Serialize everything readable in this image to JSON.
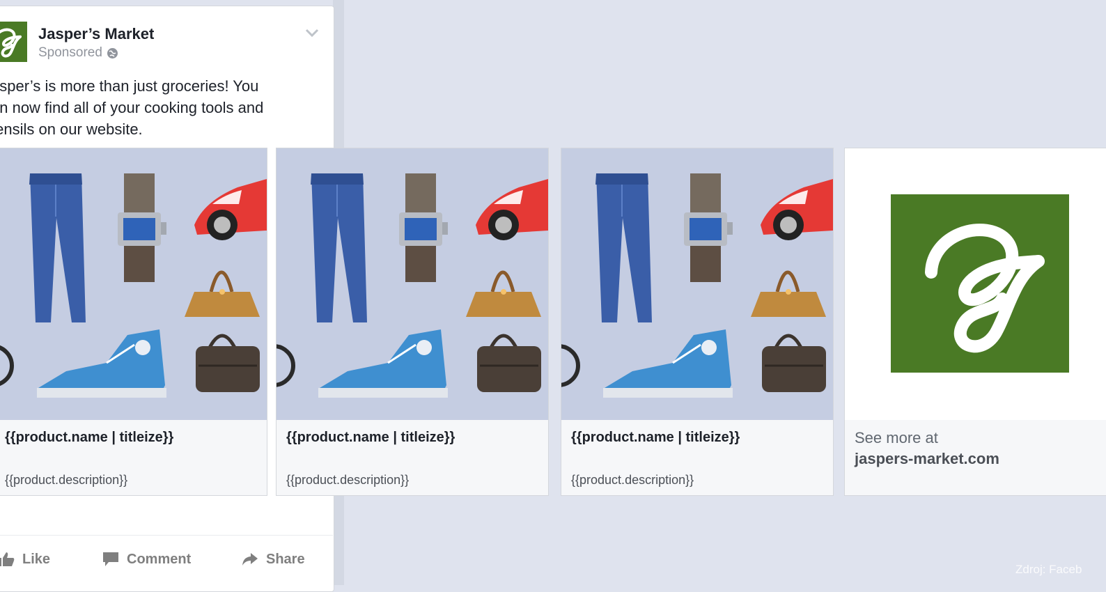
{
  "post": {
    "page_name": "Jasper’s Market",
    "sponsored_label": "Sponsored",
    "text": "asper’s is more than just groceries! You\nan now find all of your cooking tools and\ntensils on our website.",
    "icons": {
      "avatar": "jaspers-logo",
      "privacy": "globe-icon",
      "menu": "chevron-down-icon"
    }
  },
  "carousel": {
    "cards": [
      {
        "title": "{{product.name | titleize}}",
        "description": "{{product.description}}",
        "image": "products-collage"
      },
      {
        "title": "{{product.name | titleize}}",
        "description": "{{product.description}}",
        "image": "products-collage"
      },
      {
        "title": "{{product.name | titleize}}",
        "description": "{{product.description}}",
        "image": "products-collage"
      }
    ],
    "end_card": {
      "see_more": "See more at",
      "site": "jaspers-market.com",
      "logo": "jaspers-logo"
    }
  },
  "actions": {
    "like": "Like",
    "comment": "Comment",
    "share": "Share"
  },
  "source": "Zdroj: Faceb",
  "colors": {
    "background": "#dfe3ee",
    "brand_green": "#4a7a25",
    "card_image_bg": "#c5cde2",
    "jeans": "#3a5ea8",
    "car": "#e53935",
    "sneaker": "#3f8fd0"
  }
}
